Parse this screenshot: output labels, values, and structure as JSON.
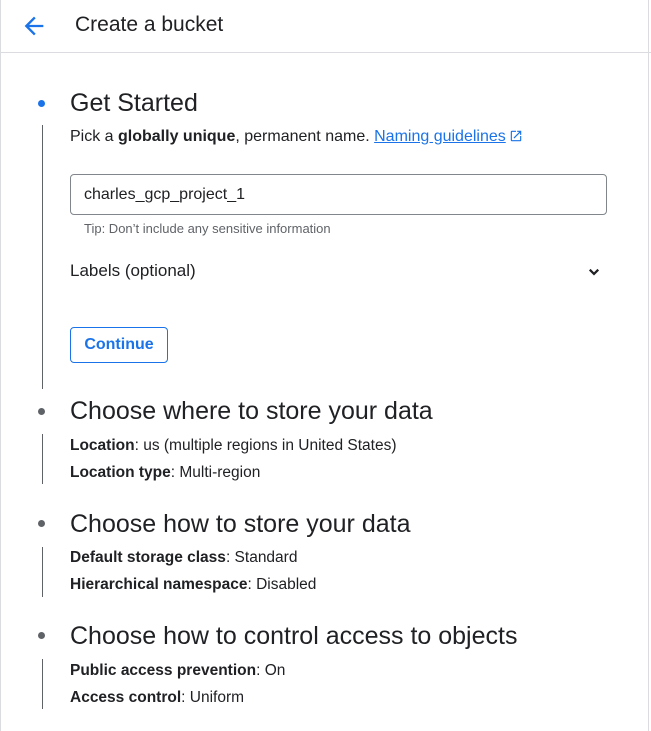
{
  "header": {
    "title": "Create a bucket",
    "back_icon": "arrow-back-icon"
  },
  "colors": {
    "accent": "#1a73e8",
    "text": "#202124",
    "muted": "#5f6368"
  },
  "steps": [
    {
      "title": "Get Started",
      "description": {
        "prefix": "Pick a ",
        "bold": "globally unique",
        "suffix": ", permanent name. ",
        "link": "Naming guidelines",
        "link_icon": "open-in-new-icon"
      },
      "name_input": {
        "value": "charles_gcp_project_1"
      },
      "hint": "Tip: Don’t include any sensitive information",
      "labels": {
        "label": "Labels (optional)",
        "icon": "chevron-down-icon"
      },
      "continue_label": "Continue"
    },
    {
      "title": "Choose where to store your data",
      "details": [
        {
          "key": "Location",
          "value": ": us (multiple regions in United States)"
        },
        {
          "key": "Location type",
          "value": ": Multi-region"
        }
      ]
    },
    {
      "title": "Choose how to store your data",
      "details": [
        {
          "key": "Default storage class",
          "value": ": Standard"
        },
        {
          "key": "Hierarchical namespace",
          "value": ": Disabled"
        }
      ]
    },
    {
      "title": "Choose how to control access to objects",
      "details": [
        {
          "key": "Public access prevention",
          "value": ": On"
        },
        {
          "key": "Access control",
          "value": ": Uniform"
        }
      ]
    }
  ]
}
